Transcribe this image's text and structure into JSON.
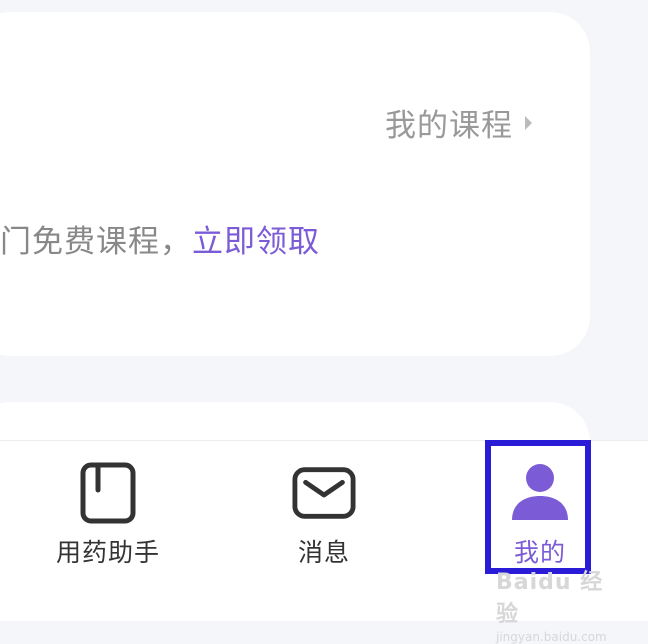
{
  "course_card": {
    "my_courses_link": "我的课程",
    "promo_text": "门免费课程，",
    "promo_action": "立即领取"
  },
  "tab_bar": {
    "tabs": [
      {
        "label": "用药助手",
        "icon": "medicine-box-icon",
        "active": false
      },
      {
        "label": "消息",
        "icon": "envelope-icon",
        "active": false
      },
      {
        "label": "我的",
        "icon": "person-icon",
        "active": true
      }
    ]
  },
  "watermark": {
    "brand": "Baidu 经验",
    "url": "jingyan.baidu.com"
  },
  "colors": {
    "accent": "#7b5cd6",
    "highlight_box": "#2a1bd6",
    "page_background": "#f5f6fa"
  }
}
